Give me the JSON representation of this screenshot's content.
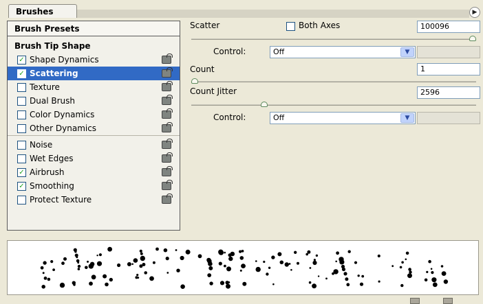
{
  "panel": {
    "tab_label": "Brushes",
    "menu_icon": "flyout-arrow-icon"
  },
  "left": {
    "presets_label": "Brush Presets",
    "tip_shape_label": "Brush Tip Shape",
    "options": [
      {
        "label": "Shape Dynamics",
        "checked": true,
        "selected": false
      },
      {
        "label": "Scattering",
        "checked": true,
        "selected": true
      },
      {
        "label": "Texture",
        "checked": false,
        "selected": false
      },
      {
        "label": "Dual Brush",
        "checked": false,
        "selected": false
      },
      {
        "label": "Color Dynamics",
        "checked": false,
        "selected": false
      },
      {
        "label": "Other Dynamics",
        "checked": false,
        "selected": false
      },
      {
        "label": "Noise",
        "checked": false,
        "selected": false
      },
      {
        "label": "Wet Edges",
        "checked": false,
        "selected": false
      },
      {
        "label": "Airbrush",
        "checked": true,
        "selected": false
      },
      {
        "label": "Smoothing",
        "checked": true,
        "selected": false
      },
      {
        "label": "Protect Texture",
        "checked": false,
        "selected": false
      }
    ]
  },
  "right": {
    "scatter": {
      "label": "Scatter",
      "both_axes_label": "Both Axes",
      "both_axes_checked": false,
      "value": "100096",
      "slider_fraction": 1.0
    },
    "control1": {
      "label": "Control:",
      "value": "Off"
    },
    "count": {
      "label": "Count",
      "value": "1",
      "slider_fraction": 0.0
    },
    "count_jitter": {
      "label": "Count Jitter",
      "value": "2596",
      "slider_fraction": 0.25
    },
    "control2": {
      "label": "Control:",
      "value": "Off"
    }
  },
  "colors": {
    "selection": "#316ac5",
    "check": "#21a121"
  }
}
